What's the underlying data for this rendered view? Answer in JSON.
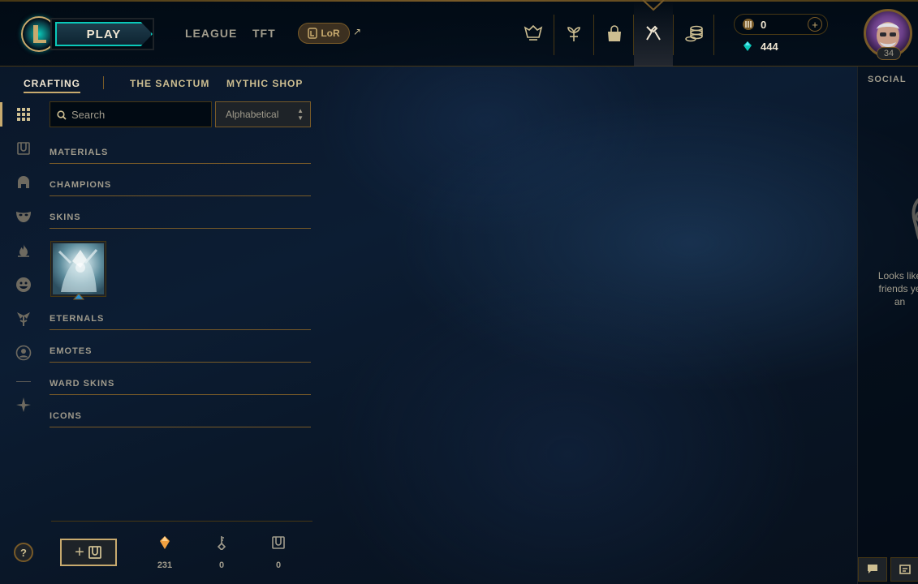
{
  "header": {
    "play_label": "PLAY",
    "nav": [
      {
        "label": "LEAGUE"
      },
      {
        "label": "TFT"
      }
    ],
    "lor_label": "LoR",
    "icons": [
      "trophy-icon",
      "clash-icon",
      "store-bag-icon",
      "crafting-hammer-icon",
      "coin-stack-icon"
    ],
    "active_icon": "crafting-hammer-icon",
    "currency": {
      "rp_value": "0",
      "blue_essence_value": "444"
    },
    "level": "34"
  },
  "subnav": {
    "items": [
      {
        "label": "CRAFTING",
        "active": true
      },
      {
        "label": "THE SANCTUM",
        "active": false
      },
      {
        "label": "MYTHIC SHOP",
        "active": false
      }
    ]
  },
  "rail": {
    "icons": [
      "grid-icon",
      "chest-icon",
      "helmet-icon",
      "mask-icon",
      "flame-icon",
      "emote-face-icon",
      "ward-icon",
      "profile-icon",
      "mythic-sigil-icon"
    ],
    "active": "grid-icon"
  },
  "filters": {
    "search_placeholder": "Search",
    "sort_value": "Alphabetical"
  },
  "categories": [
    {
      "label": "MATERIALS"
    },
    {
      "label": "CHAMPIONS"
    },
    {
      "label": "SKINS"
    },
    {
      "label": "ETERNALS"
    },
    {
      "label": "EMOTES"
    },
    {
      "label": "WARD SKINS"
    },
    {
      "label": "ICONS"
    }
  ],
  "footer": {
    "help_label": "?",
    "add_label": "+",
    "stats": [
      {
        "icon": "orange-essence-icon",
        "value": "231"
      },
      {
        "icon": "key-icon",
        "value": "0"
      },
      {
        "icon": "chest-icon",
        "value": "0"
      }
    ]
  },
  "social": {
    "title": "SOCIAL",
    "empty_message_lines": [
      "Looks like",
      "friends ye",
      "an"
    ]
  },
  "colors": {
    "gold": "#c8aa6e",
    "gold_dark": "#785a28",
    "teal": "#0ac8b9",
    "text_muted": "#a09b8c",
    "essence_orange": "#f0a040"
  }
}
